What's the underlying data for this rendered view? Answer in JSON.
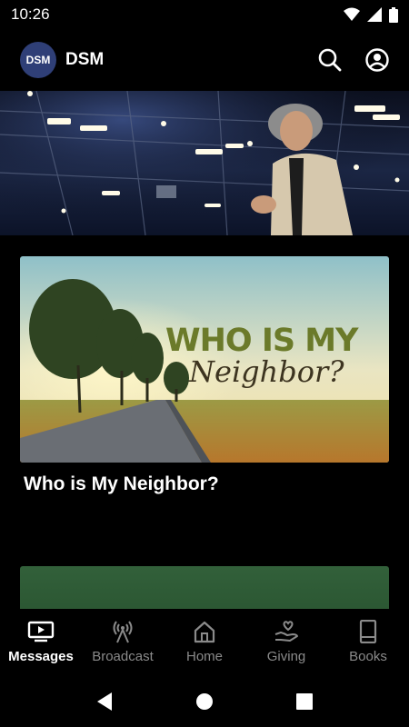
{
  "status_bar": {
    "time": "10:26"
  },
  "app_bar": {
    "logo_text": "DSM",
    "title": "DSM"
  },
  "featured": {
    "title": "Who is My Neighbor?",
    "art_headline": "WHO IS MY",
    "art_script": "Neighbor?"
  },
  "bottom_nav": {
    "items": [
      {
        "label": "Messages",
        "icon": "tv-play-icon",
        "active": true
      },
      {
        "label": "Broadcast",
        "icon": "antenna-icon",
        "active": false
      },
      {
        "label": "Home",
        "icon": "home-icon",
        "active": false
      },
      {
        "label": "Giving",
        "icon": "heart-hand-icon",
        "active": false
      },
      {
        "label": "Books",
        "icon": "book-icon",
        "active": false
      }
    ]
  },
  "colors": {
    "background": "#000000",
    "logo_bg": "#2f3f77",
    "art_headline": "#6b7a2a",
    "inactive_nav": "#8a8a8a"
  }
}
